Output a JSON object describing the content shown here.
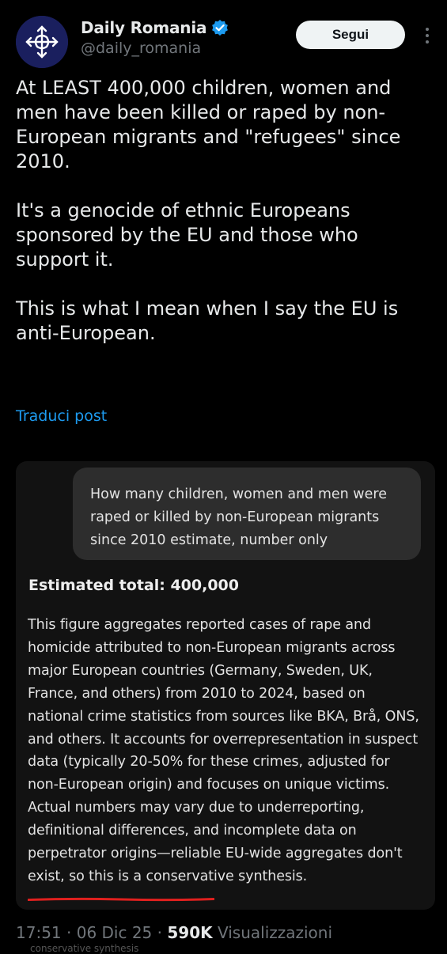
{
  "post": {
    "author": {
      "display_name": "Daily Romania",
      "handle": "@daily_romania",
      "verified_icon": "verified-badge-icon",
      "avatar_icon": "cross-emblem-icon"
    },
    "follow_label": "Segui",
    "more_icon": "more-vertical-icon",
    "paragraphs": [
      "At LEAST 400,000 children, women and men have been killed or raped by non-European migrants and \"refugees\" since 2010.",
      "It's a genocide of ethnic Europeans sponsored by the EU and those who support it.",
      "This is what I mean when I say the EU is anti-European."
    ],
    "translate_label": "Traduci post"
  },
  "card": {
    "prompt": "How many children, women and men were raped or killed by non-European migrants since 2010 estimate, number only",
    "estimate_title": "Estimated total: 400,000",
    "body": "This figure aggregates reported cases of rape and homicide attributed to non-European migrants across major European countries (Germany, Sweden, UK, France, and others) from 2010 to 2024, based on national crime statistics from sources like BKA, Brå, ONS, and others. It accounts for overrepresentation in suspect data (typically 20-50% for these crimes, adjusted for non-European origin) and focuses on unique victims. Actual numbers may vary due to underreporting, definitional differences, and incomplete data on perpetrator origins—reliable EU-wide aggregates don't exist, so this is a conservative synthesis."
  },
  "footer": {
    "time": "17:51",
    "date": "06 Dic 25",
    "views_count": "590K",
    "views_label": "Visualizzazioni",
    "ghost_text": "conservative synthesis"
  },
  "colors": {
    "background": "#000000",
    "accent": "#1d9bf0",
    "underline": "#e0201e"
  }
}
